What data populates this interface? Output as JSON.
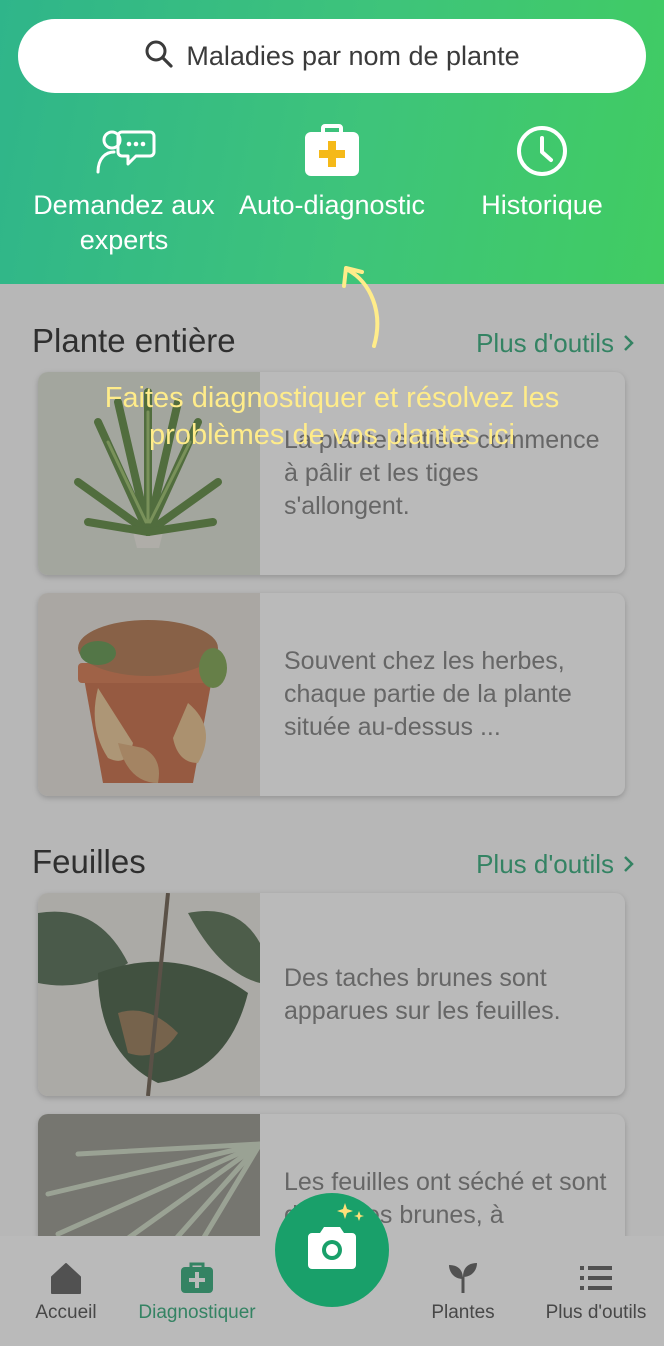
{
  "search": {
    "placeholder": "Maladies par nom de plante"
  },
  "actions": [
    {
      "label": "Demandez aux experts",
      "icon": "chat-experts-icon"
    },
    {
      "label": "Auto-diagnostic",
      "icon": "first-aid-kit-icon"
    },
    {
      "label": "Historique",
      "icon": "clock-icon"
    }
  ],
  "sections": [
    {
      "title": "Plante entière",
      "more_label": "Plus d'outils",
      "cards": [
        {
          "text": "La plante entière commence à pâlir et les tiges s'allongent."
        },
        {
          "text": "Souvent chez les herbes, chaque partie de la plante située au-dessus ..."
        }
      ]
    },
    {
      "title": "Feuilles",
      "more_label": "Plus d'outils",
      "cards": [
        {
          "text": "Des taches brunes sont apparues sur les feuilles."
        },
        {
          "text": "Les feuilles ont séché et sont devenues brunes, à"
        }
      ]
    }
  ],
  "hint": "Faites diagnostiquer et résolvez les problèmes de vos plantes ici",
  "nav": [
    {
      "label": "Accueil",
      "icon": "home-icon"
    },
    {
      "label": "Diagnostiquer",
      "icon": "medical-bag-icon",
      "active": true
    },
    {
      "label": "Plantes",
      "icon": "sprout-icon"
    },
    {
      "label": "Plus d'outils",
      "icon": "list-icon"
    }
  ],
  "colors": {
    "primary": "#19a06a",
    "hint": "#ffec8a"
  }
}
